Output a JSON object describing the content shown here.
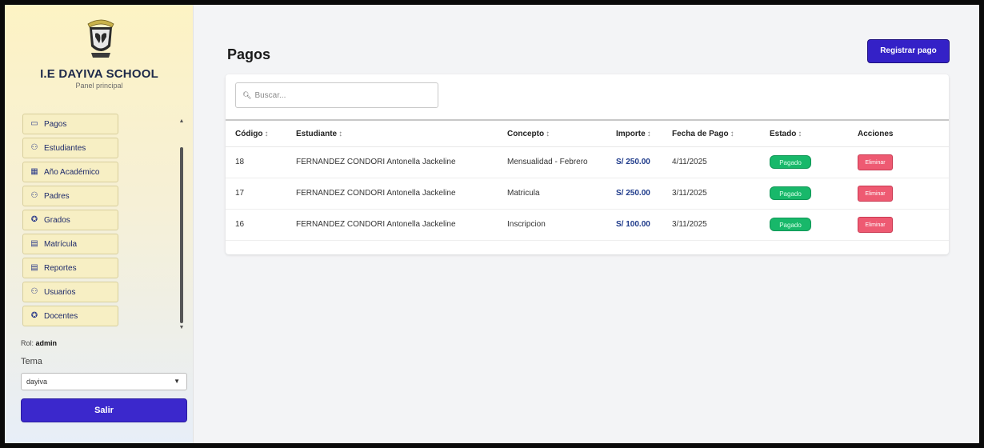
{
  "sidebar": {
    "school_name": "I.E DAYIVA SCHOOL",
    "subtitle": "Panel principal",
    "items": [
      {
        "label": "Pagos",
        "icon": "card-icon"
      },
      {
        "label": "Estudiantes",
        "icon": "users-icon"
      },
      {
        "label": "Año Académico",
        "icon": "calendar-icon"
      },
      {
        "label": "Padres",
        "icon": "users-icon"
      },
      {
        "label": "Grados",
        "icon": "graduation-icon"
      },
      {
        "label": "Matrícula",
        "icon": "document-icon"
      },
      {
        "label": "Reportes",
        "icon": "document-icon"
      },
      {
        "label": "Usuarios",
        "icon": "users-icon"
      },
      {
        "label": "Docentes",
        "icon": "graduation-icon"
      }
    ],
    "user_prefix": "Rol:",
    "user_role": "admin",
    "tema_label": "Tema",
    "tema_value": "dayiva",
    "logout_label": "Salir"
  },
  "main": {
    "title": "Pagos",
    "register_label": "Registrar pago",
    "search_placeholder": "Buscar...",
    "columns": [
      "Código",
      "Estudiante",
      "Concepto",
      "Importe",
      "Fecha de Pago",
      "Estado",
      "Acciones"
    ],
    "rows": [
      {
        "codigo": "18",
        "estudiante": "FERNANDEZ CONDORI Antonella Jackeline",
        "concepto": "Mensualidad - Febrero",
        "importe": "S/ 250.00",
        "fecha": "4/11/2025",
        "estado": "Pagado",
        "accion": "Eliminar"
      },
      {
        "codigo": "17",
        "estudiante": "FERNANDEZ CONDORI Antonella Jackeline",
        "concepto": "Matricula",
        "importe": "S/ 250.00",
        "fecha": "3/11/2025",
        "estado": "Pagado",
        "accion": "Eliminar"
      },
      {
        "codigo": "16",
        "estudiante": "FERNANDEZ CONDORI Antonella Jackeline",
        "concepto": "Inscripcion",
        "importe": "S/ 100.00",
        "fecha": "3/11/2025",
        "estado": "Pagado",
        "accion": "Eliminar"
      }
    ]
  },
  "colors": {
    "accent": "#3421c7",
    "paid": "#18b86a",
    "delete": "#ee5a72"
  }
}
